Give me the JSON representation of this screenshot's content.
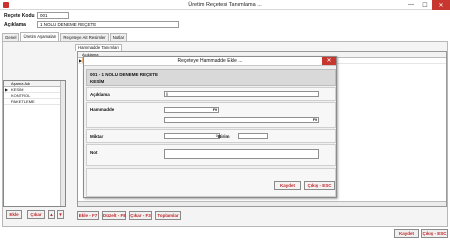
{
  "window": {
    "title": "Üretim Reçetesi Tanımlama ...",
    "controls": {
      "minimize": "—",
      "maximize": "☐",
      "close": "✕"
    }
  },
  "header": {
    "code_label": "Reçete Kodu",
    "code_value": "001",
    "desc_label": "Açıklama",
    "desc_value": "1 NOLU DENEME REÇETE"
  },
  "tabs": [
    {
      "label": "Genel",
      "active": false
    },
    {
      "label": "Üretim Aşamaları",
      "active": true
    },
    {
      "label": "Reçeteye Ait Resimler",
      "active": false
    },
    {
      "label": "Notlar",
      "active": false
    }
  ],
  "left_list": {
    "column": "Aşama Adı",
    "rows": [
      "KESİM",
      "KONTROL",
      "PAKETLEME"
    ],
    "selected_index": 0
  },
  "left_buttons": {
    "add": "Ekle",
    "remove": "Çıkar",
    "up": "▲",
    "down": "▼"
  },
  "right_panel": {
    "tab": "Hammadde Tanımları",
    "column": "Açıklama",
    "selected_row": 0
  },
  "bottom_buttons": {
    "add": "Ekle - F7",
    "edit": "Düzelt - F8",
    "remove": "Çıkar - F3",
    "totals": "Toplamlar"
  },
  "main_buttons": {
    "save": "Kaydet",
    "exit": "Çıkış - ESC"
  },
  "dialog": {
    "title": "Reçeteye Hammadde Ekle ...",
    "close": "✕",
    "line1": "001 - 1 NOLU DENEME REÇETE",
    "line2": "KESİM",
    "desc_label": "Açıklama",
    "desc_value": "||",
    "material_label": "Hammadde",
    "material_f9_a": "F9",
    "material_f9_b": "F9",
    "qty_label": "Miktar",
    "qty_value": "0",
    "unit_label": "Birim",
    "unit_value": "",
    "note_label": "Not",
    "note_value": "",
    "save": "Kaydet",
    "exit": "Çıkış - ESC"
  },
  "colors": {
    "accent_red": "#c0282b",
    "close_red": "#c7372f",
    "selection_orange": "#f7c58a"
  }
}
